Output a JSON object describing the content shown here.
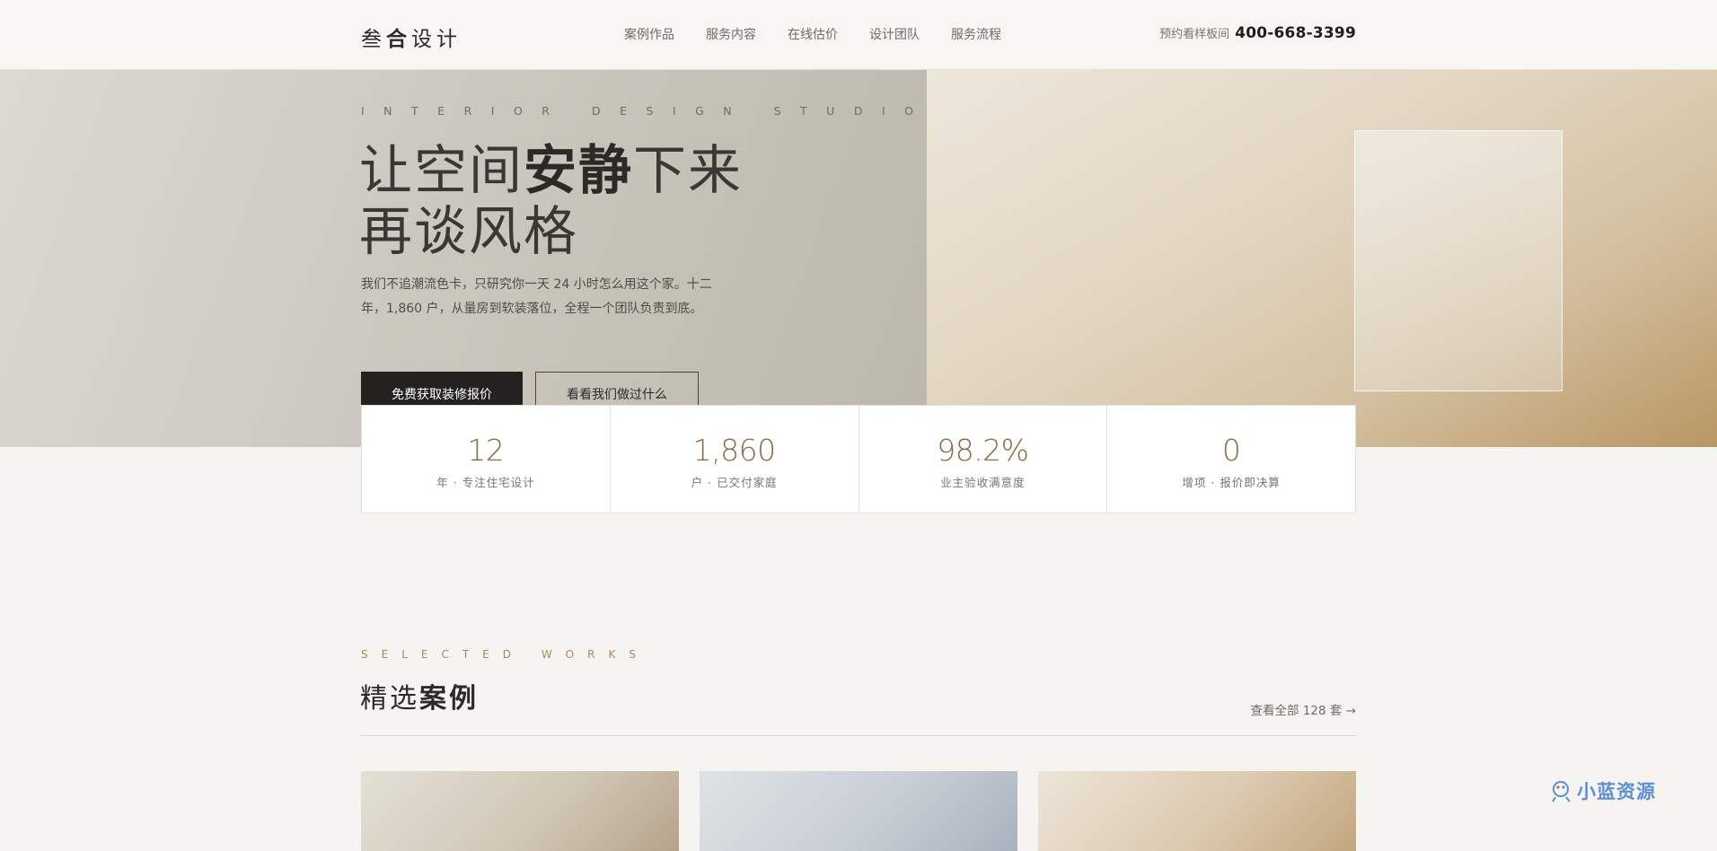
{
  "header": {
    "logo": {
      "part1": "叁",
      "part2": "合",
      "part3": "设计"
    },
    "nav": [
      "案例作品",
      "服务内容",
      "在线估价",
      "设计团队",
      "服务流程"
    ],
    "hotline_label": "预约看样板间",
    "hotline_number": "400-668-3399"
  },
  "hero": {
    "eyebrow": "INTERIOR DESIGN STUDIO",
    "headline_line1_a": "让空间",
    "headline_line1_b": "安静",
    "headline_line1_c": "下来",
    "headline_line2": "再谈风格",
    "description": "我们不追潮流色卡，只研究你一天 24 小时怎么用这个家。十二年，1,860 户，从量房到软装落位，全程一个团队负责到底。",
    "primary_button": "免费获取装修报价",
    "secondary_button": "看看我们做过什么"
  },
  "stats": [
    {
      "value": "12",
      "label": "年 · 专注住宅设计"
    },
    {
      "value": "1,860",
      "label": "户 · 已交付家庭"
    },
    {
      "value": "98.2%",
      "label": "业主验收满意度"
    },
    {
      "value": "0",
      "label": "增项 · 报价即决算"
    }
  ],
  "works": {
    "eyebrow": "SELECTED WORKS",
    "title_a": "精选",
    "title_b": "案例",
    "view_all": "查看全部 128 套 →"
  },
  "watermark": {
    "text": "小蓝资源"
  },
  "colors": {
    "accent": "#8c6a45",
    "dark": "#23221f",
    "background": "#f5f4f0",
    "watermark": "#5b8fd9"
  }
}
